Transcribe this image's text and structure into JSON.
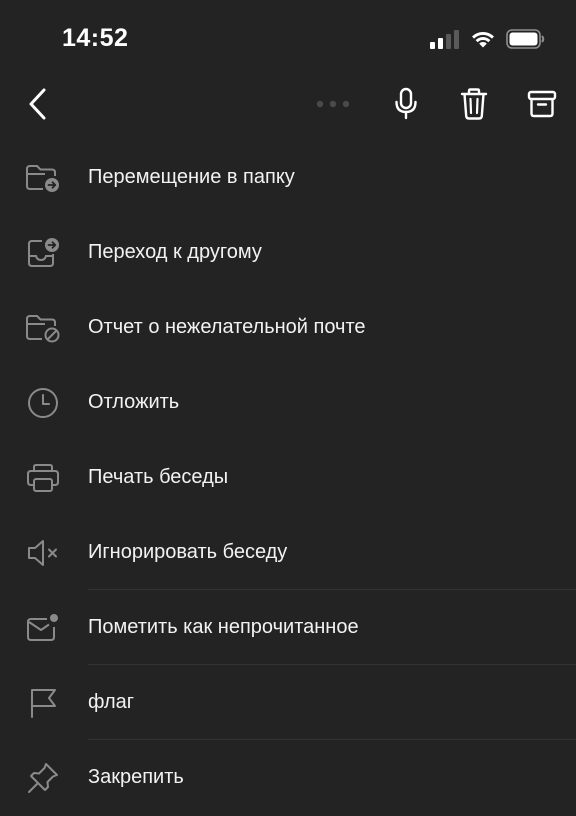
{
  "status": {
    "time": "14:52"
  },
  "toolbar": {
    "back_icon": "chevron-left-icon",
    "more_icon": "more-dots-icon",
    "mic_icon": "microphone-icon",
    "trash_icon": "trash-icon",
    "archive_icon": "archive-icon"
  },
  "menu": {
    "items": [
      {
        "label": "Перемещение в папку",
        "icon": "folder-move-icon"
      },
      {
        "label": "Переход к другому",
        "icon": "inbox-switch-icon"
      },
      {
        "label": "Отчет о нежелательной почте",
        "icon": "folder-block-icon"
      },
      {
        "label": "Отложить",
        "icon": "clock-icon"
      },
      {
        "label": "Печать беседы",
        "icon": "printer-icon"
      },
      {
        "label": "Игнорировать беседу",
        "icon": "speaker-mute-icon"
      },
      {
        "label": "Пометить как непрочитанное",
        "icon": "mail-unread-icon"
      },
      {
        "label": "флаг",
        "icon": "flag-icon"
      },
      {
        "label": "Закрепить",
        "icon": "pin-icon"
      }
    ]
  },
  "colors": {
    "background": "#232323",
    "text": "#f2f2f2",
    "icon": "#8a8a8a",
    "toolbar_icon": "#ffffff",
    "divider": "#333333"
  }
}
